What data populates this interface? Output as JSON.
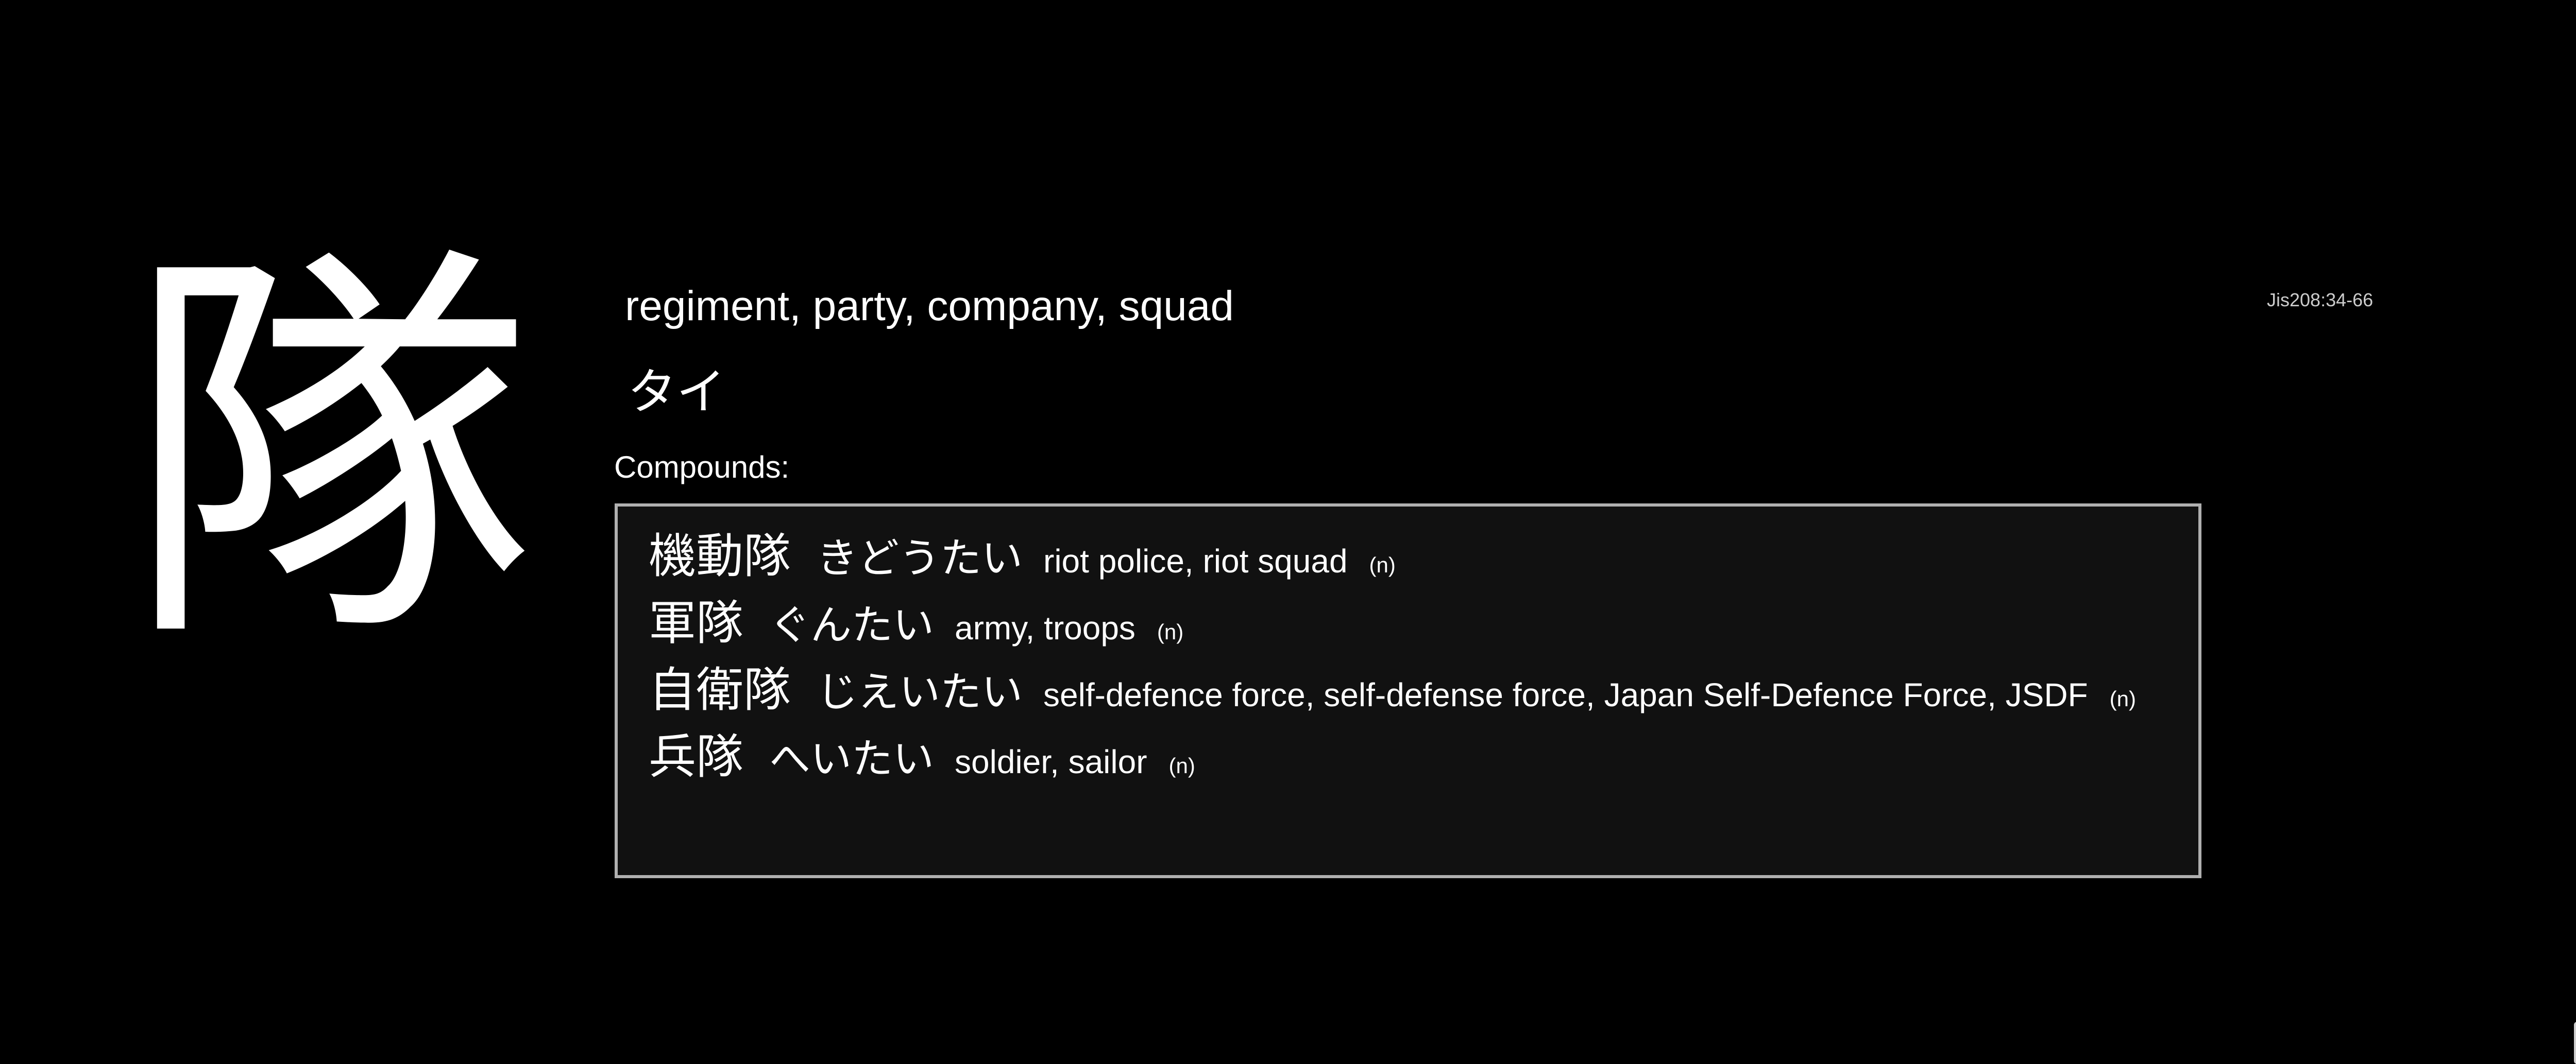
{
  "kanji": {
    "character": "隊",
    "meaning": "regiment, party, company, squad",
    "reading": "タイ",
    "jis_code": "Jis208:34-66"
  },
  "compounds": {
    "label": "Compounds:",
    "items": [
      {
        "word": "機動隊",
        "reading": "きどうたい",
        "gloss": "riot police, riot squad",
        "pos": "(n)"
      },
      {
        "word": "軍隊",
        "reading": "ぐんたい",
        "gloss": "army, troops",
        "pos": "(n)"
      },
      {
        "word": "自衛隊",
        "reading": "じえいたい",
        "gloss": "self-defence force, self-defense force, Japan Self-Defence Force, JSDF",
        "pos": "(n)"
      },
      {
        "word": "兵隊",
        "reading": "へいたい",
        "gloss": "soldier, sailor",
        "pos": "(n)"
      }
    ]
  },
  "colors": {
    "background": "#000000",
    "text": "#ffffff",
    "box_background": "#111111",
    "box_border": "#b0b0b0"
  }
}
